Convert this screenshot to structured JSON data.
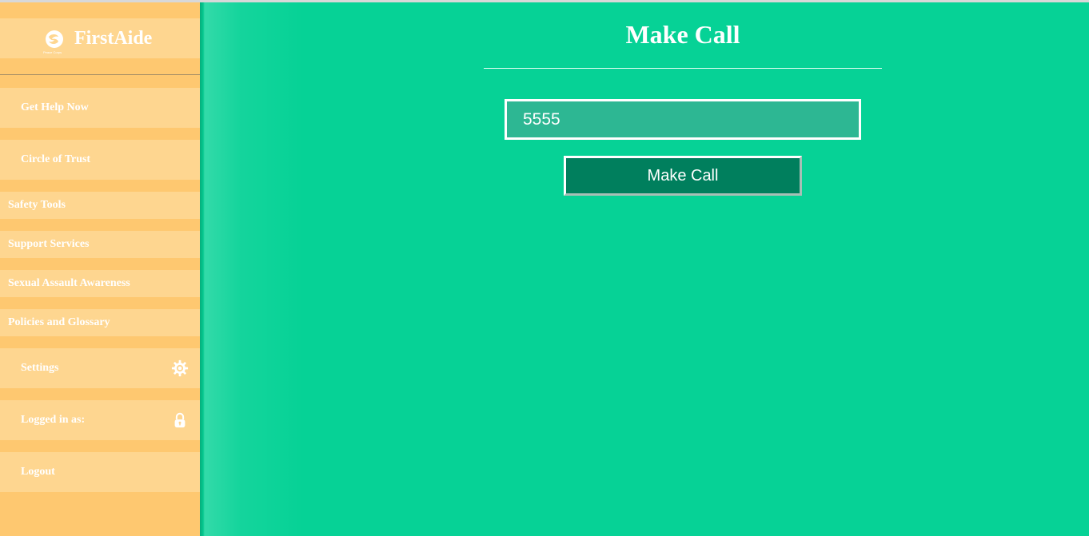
{
  "app": {
    "name": "FirstAide",
    "logo_subtitle": "Peace Corps"
  },
  "sidebar": {
    "items": [
      {
        "label": "Get Help Now"
      },
      {
        "label": "Circle of Trust"
      },
      {
        "label": "Safety Tools"
      },
      {
        "label": "Support Services"
      },
      {
        "label": "Sexual Assault Awareness"
      },
      {
        "label": "Policies and Glossary"
      },
      {
        "label": "Settings",
        "icon": "gear-icon"
      },
      {
        "label": "Logged in as:",
        "icon": "lock-icon"
      },
      {
        "label": "Logout"
      }
    ]
  },
  "main": {
    "title": "Make Call",
    "phone_value": "5555",
    "call_button_label": "Make Call"
  },
  "colors": {
    "main_background": "#06d296",
    "sidebar_background": "#fec870",
    "sidebar_item": "#fed690",
    "input_background": "#2db793",
    "button_background": "#007f5d"
  }
}
